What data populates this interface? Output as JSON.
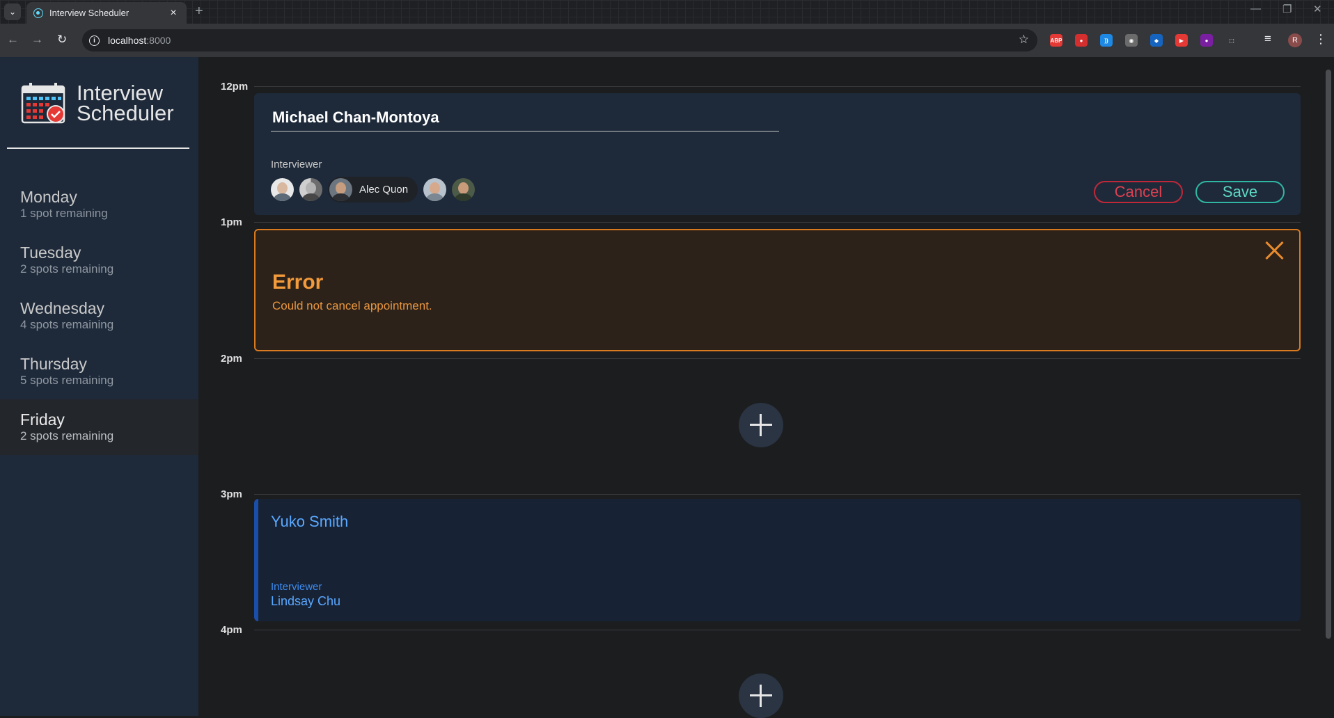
{
  "browser": {
    "tab_title": "Interview Scheduler",
    "url_host": "localhost",
    "url_port": ":8000",
    "profile_initial": "R",
    "extensions": [
      {
        "label": "ABP",
        "color": "#e53935"
      },
      {
        "label": "●",
        "color": "#d32f2f"
      },
      {
        "label": "))",
        "color": "#1e88e5"
      },
      {
        "label": "◉",
        "color": "#6b6b6b"
      },
      {
        "label": "◆",
        "color": "#1565c0"
      },
      {
        "label": "▶",
        "color": "#e53935"
      },
      {
        "label": "●",
        "color": "#7b1fa2"
      },
      {
        "label": "⬚",
        "color": "#35363a"
      }
    ]
  },
  "app": {
    "title_line1": "Interview",
    "title_line2": "Scheduler"
  },
  "days": [
    {
      "name": "Monday",
      "spots": "1 spot remaining",
      "selected": false
    },
    {
      "name": "Tuesday",
      "spots": "2 spots remaining",
      "selected": false
    },
    {
      "name": "Wednesday",
      "spots": "4 spots remaining",
      "selected": false
    },
    {
      "name": "Thursday",
      "spots": "5 spots remaining",
      "selected": false
    },
    {
      "name": "Friday",
      "spots": "2 spots remaining",
      "selected": true
    }
  ],
  "times": [
    "12pm",
    "1pm",
    "2pm",
    "3pm",
    "4pm"
  ],
  "form": {
    "student_name": "Michael Chan-Montoya",
    "interviewer_label": "Interviewer",
    "selected_interviewer": "Alec Quon",
    "cancel_label": "Cancel",
    "save_label": "Save"
  },
  "error": {
    "title": "Error",
    "message": "Could not cancel appointment."
  },
  "booked": {
    "student": "Yuko Smith",
    "interviewer_label": "Interviewer",
    "interviewer_name": "Lindsay Chu"
  },
  "colors": {
    "sidebar_bg": "#1e2a3a",
    "accent_danger": "#e04050",
    "accent_success": "#5fd9c4",
    "error_accent": "#f39a3b",
    "booked_accent": "#5aa8ff"
  }
}
